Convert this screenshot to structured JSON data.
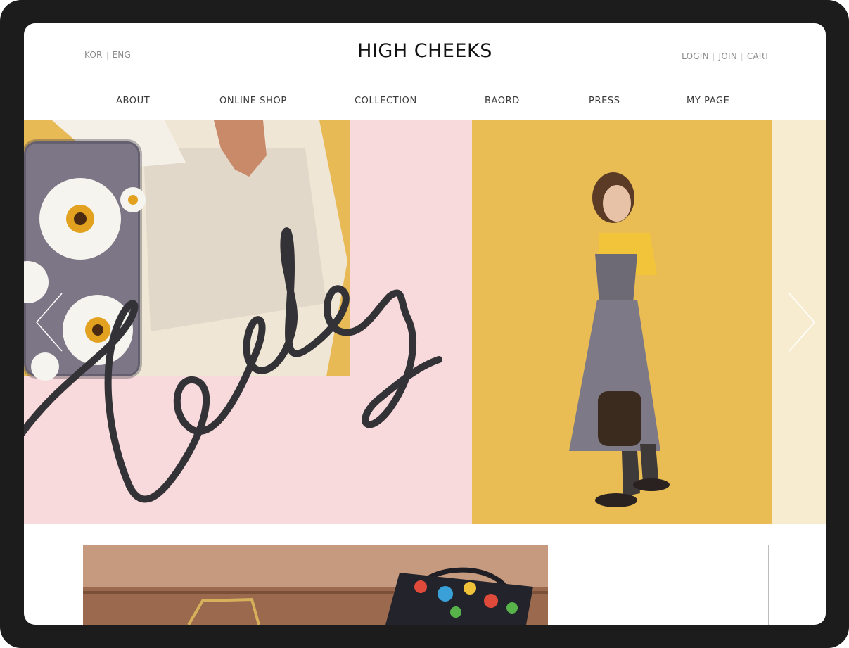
{
  "header": {
    "lang": [
      "KOR",
      "ENG"
    ],
    "logo": "HIGH CHEEKS",
    "user_links": [
      "LOGIN",
      "JOIN",
      "CART"
    ]
  },
  "nav": {
    "items": [
      "ABOUT",
      "ONLINE SHOP",
      "COLLECTION",
      "BAORD",
      "PRESS",
      "MY PAGE"
    ]
  },
  "hero": {
    "script_word": "heyday"
  },
  "colors": {
    "hero_pink": "#f8d9dc",
    "hero_yellow": "#e9bd54",
    "hero_cream": "#f7ecd0",
    "device_frame": "#1c1c1c"
  },
  "icons": {
    "prev": "chevron-left-icon",
    "next": "chevron-right-icon"
  }
}
